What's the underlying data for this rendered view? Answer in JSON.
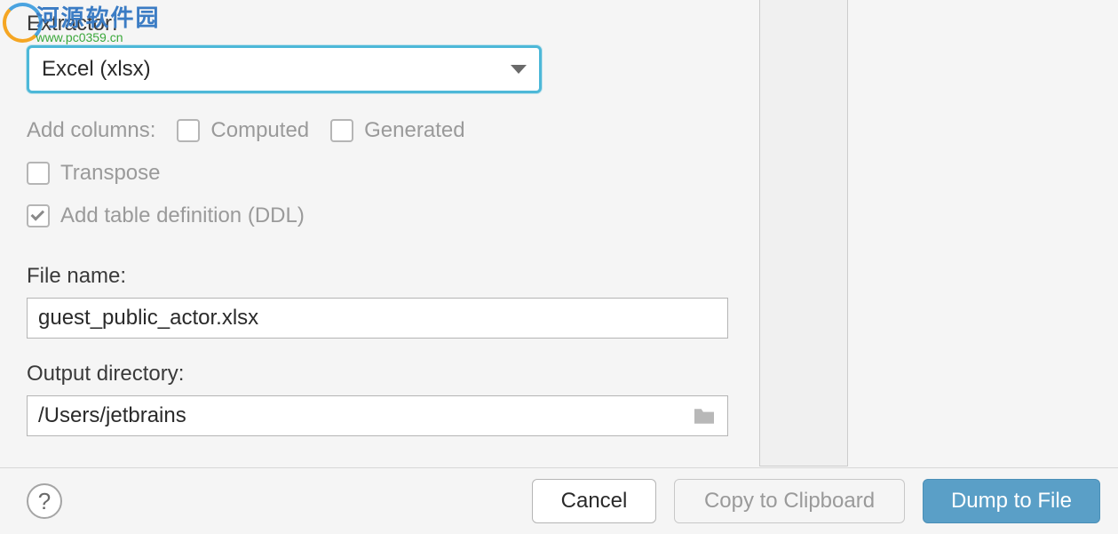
{
  "watermark": {
    "cn": "河源软件园",
    "url": "www.pc0359.cn"
  },
  "extractor": {
    "label": "Extractor:",
    "value": "Excel (xlsx)"
  },
  "addColumns": {
    "label": "Add columns:",
    "computed": "Computed",
    "generated": "Generated"
  },
  "options": {
    "transpose": "Transpose",
    "ddl": "Add table definition (DDL)"
  },
  "fileName": {
    "label": "File name:",
    "value": "guest_public_actor.xlsx"
  },
  "outputDir": {
    "label": "Output directory:",
    "value": "/Users/jetbrains"
  },
  "buttons": {
    "cancel": "Cancel",
    "copy": "Copy to Clipboard",
    "dump": "Dump to File"
  },
  "help": "?"
}
